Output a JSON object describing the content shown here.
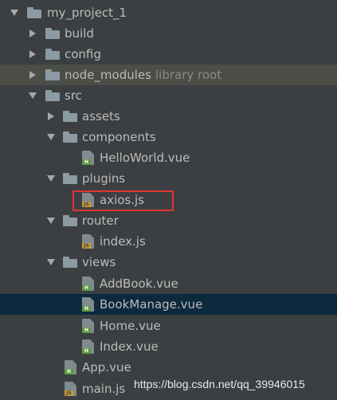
{
  "tree": {
    "root": {
      "label": "my_project_1"
    },
    "build": {
      "label": "build"
    },
    "config": {
      "label": "config"
    },
    "node_modules": {
      "label": "node_modules",
      "hint": "library root"
    },
    "src": {
      "label": "src"
    },
    "assets": {
      "label": "assets"
    },
    "components": {
      "label": "components"
    },
    "helloworld": {
      "label": "HelloWorld.vue",
      "icon": "vue-file-icon"
    },
    "plugins": {
      "label": "plugins"
    },
    "axios": {
      "label": "axios.js",
      "icon": "js-file-icon"
    },
    "router": {
      "label": "router"
    },
    "router_index": {
      "label": "index.js",
      "icon": "js-file-icon"
    },
    "views": {
      "label": "views"
    },
    "addbook": {
      "label": "AddBook.vue",
      "icon": "vue-file-icon"
    },
    "bookmanage": {
      "label": "BookManage.vue",
      "icon": "vue-file-icon"
    },
    "home": {
      "label": "Home.vue",
      "icon": "vue-file-icon"
    },
    "index_vue": {
      "label": "Index.vue",
      "icon": "vue-file-icon"
    },
    "app": {
      "label": "App.vue",
      "icon": "vue-file-icon"
    },
    "main": {
      "label": "main.js",
      "icon": "js-file-icon"
    }
  },
  "badges": {
    "vue": "H",
    "js": "JS"
  },
  "watermark": "https://blog.csdn.net/qq_39946015",
  "colors": {
    "background": "#3c3f41",
    "selected_row": "#0d293e",
    "node_modules_row": "#4b4d47",
    "highlight_box": "#e23333",
    "text": "#bbbbbb",
    "hint_text": "#8a8a8a"
  }
}
